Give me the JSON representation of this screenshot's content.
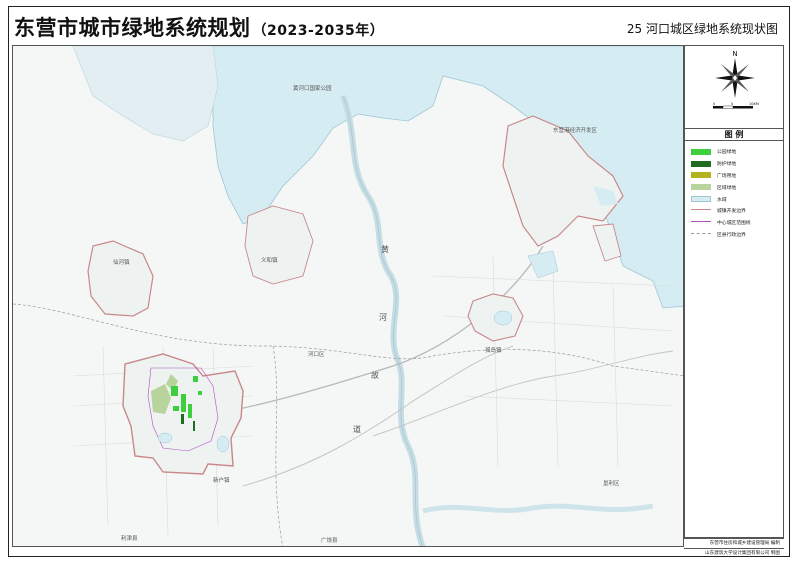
{
  "header": {
    "title": "东营市城市绿地系统规划",
    "title_years": "（2023-2035年）",
    "map_name": "25  河口城区绿地系统现状图"
  },
  "compass": {
    "north": "N",
    "scale_labels": [
      "0",
      "5",
      "10KM"
    ]
  },
  "legend": {
    "title": "图 例",
    "items": [
      {
        "label": "公园绿地",
        "kind": "fill",
        "color": "#3ecf3e"
      },
      {
        "label": "防护绿地",
        "kind": "fill",
        "color": "#1f6b1f"
      },
      {
        "label": "广场用地",
        "kind": "fill",
        "color": "#b3b31e"
      },
      {
        "label": "区域绿地",
        "kind": "fill",
        "color": "#b8d39c"
      },
      {
        "label": "水域",
        "kind": "fill",
        "color": "#d6ecf3"
      },
      {
        "label": "城镇开发边界",
        "kind": "line",
        "color": "#c8888a"
      },
      {
        "label": "中心城区范围线",
        "kind": "line",
        "color": "#b04ec0"
      },
      {
        "label": "区县行政边界",
        "kind": "line",
        "color": "#9a9a9a"
      }
    ]
  },
  "map": {
    "place_labels": [
      "黄河口国家公园",
      "孤岛镇",
      "黄",
      "河",
      "故",
      "道",
      "东营港经济开发区",
      "垦利区",
      "利津县",
      "广饶县",
      "仙河镇",
      "河口区",
      "义和镇",
      "新户镇"
    ],
    "colors": {
      "sea": "#d6ecf3",
      "land": "#f4f7f6",
      "boundary": "#c8888a",
      "park": "#3ecf3e",
      "regional": "#b8d39c"
    }
  },
  "credits": {
    "compiled_by": "东营市住房和城乡建设管理局    编制",
    "designed_by": "山东建筑大学设计集团有限公司    制图"
  }
}
